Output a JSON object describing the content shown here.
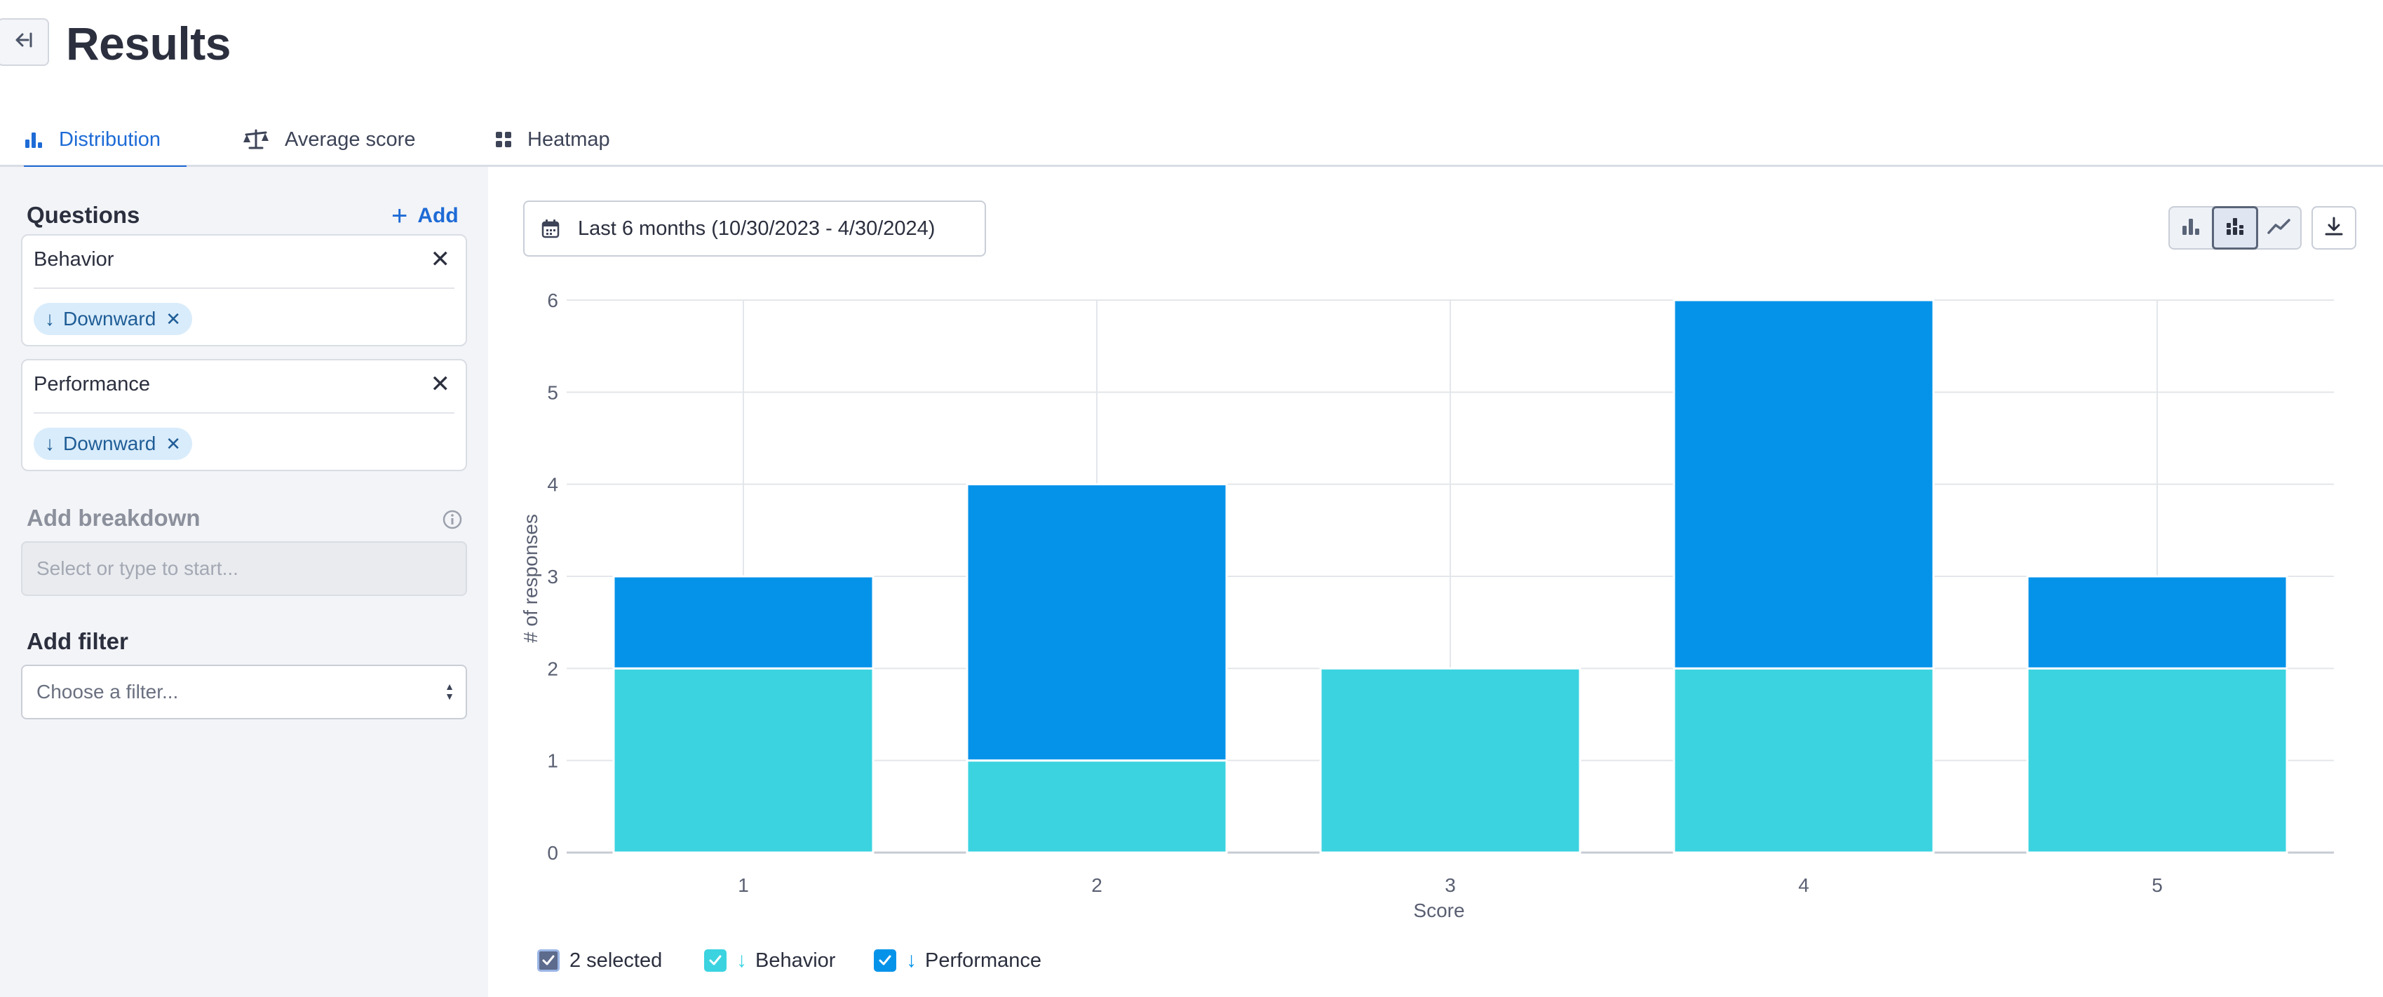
{
  "header": {
    "title": "Results",
    "back_icon": "collapse-left-icon"
  },
  "tabs": [
    {
      "label": "Distribution",
      "icon": "bar-chart-icon",
      "active": true
    },
    {
      "label": "Average score",
      "icon": "scale-icon",
      "active": false
    },
    {
      "label": "Heatmap",
      "icon": "grid-icon",
      "active": false
    }
  ],
  "sidebar": {
    "questions_title": "Questions",
    "add_label": "Add",
    "questions": [
      {
        "name": "Behavior",
        "chip": "Downward"
      },
      {
        "name": "Performance",
        "chip": "Downward"
      }
    ],
    "breakdown_title": "Add breakdown",
    "breakdown_placeholder": "Select or type to start...",
    "filter_title": "Add filter",
    "filter_placeholder": "Choose a filter..."
  },
  "toolbar": {
    "date_range": "Last 6 months (10/30/2023 - 4/30/2024)",
    "view_modes": [
      "grouped-bar-icon",
      "stacked-bar-icon",
      "line-chart-icon"
    ],
    "active_view": "stacked-bar-icon",
    "download_icon": "download-icon"
  },
  "colors": {
    "behavior": "#3bd3e0",
    "performance": "#0593ea",
    "accent": "#1e6bd6"
  },
  "chart_data": {
    "type": "bar",
    "stacked": true,
    "categories": [
      "1",
      "2",
      "3",
      "4",
      "5"
    ],
    "series": [
      {
        "name": "Behavior",
        "values": [
          2,
          1,
          2,
          2,
          2
        ]
      },
      {
        "name": "Performance",
        "values": [
          1,
          3,
          0,
          4,
          1
        ]
      }
    ],
    "xlabel": "Score",
    "ylabel": "# of responses",
    "ylim": [
      0,
      6
    ],
    "yticks": [
      0,
      1,
      2,
      3,
      4,
      5,
      6
    ],
    "grid": true
  },
  "legend": {
    "select_all_label": "2 selected",
    "items": [
      {
        "label": "Behavior",
        "arrow": "↓"
      },
      {
        "label": "Performance",
        "arrow": "↓"
      }
    ]
  }
}
